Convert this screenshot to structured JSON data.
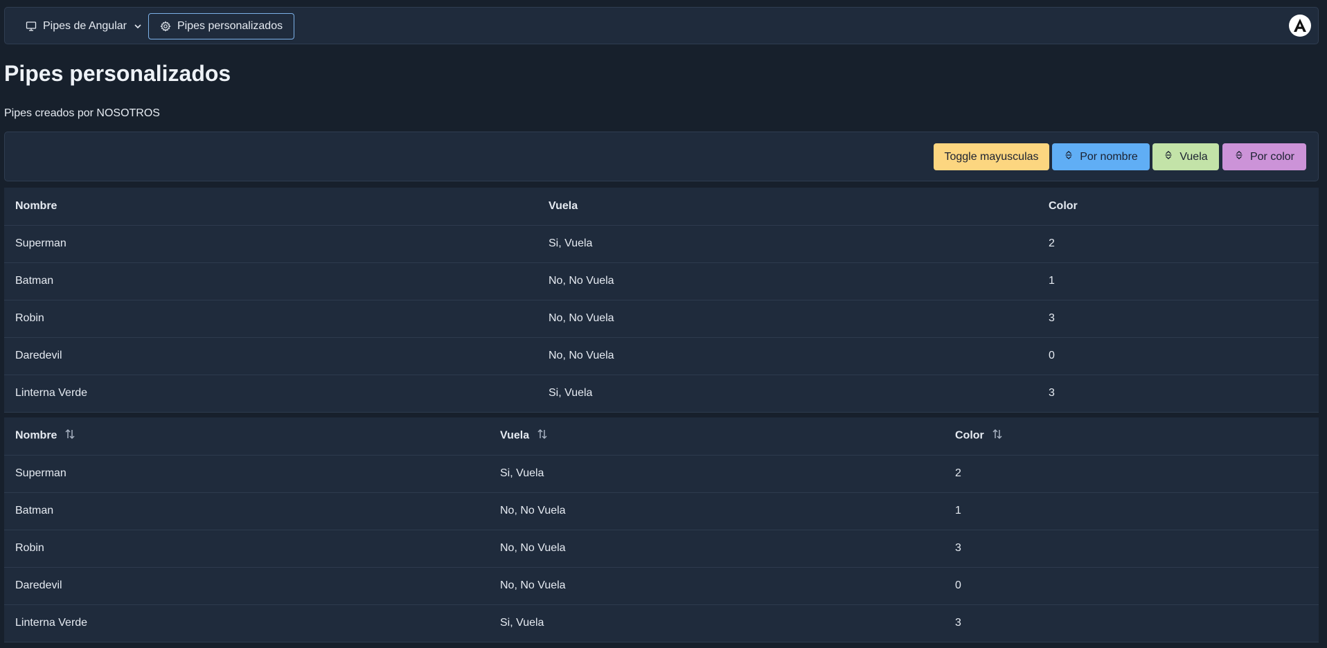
{
  "menubar": {
    "items": [
      {
        "label": "Pipes de Angular",
        "icon": "monitor-icon",
        "has_dropdown": true
      },
      {
        "label": "Pipes personalizados",
        "icon": "gear-icon",
        "active": true
      }
    ],
    "brand_icon": "angular-logo-icon"
  },
  "page": {
    "title": "Pipes personalizados",
    "subtitle": "Pipes creados por NOSOTROS"
  },
  "toolbar": {
    "buttons": [
      {
        "label": "Toggle mayusculas",
        "color": "#fcd680"
      },
      {
        "label": "Por nombre",
        "icon": "sort-alt-icon",
        "color": "#60aef5"
      },
      {
        "label": "Vuela",
        "icon": "sort-alt-icon",
        "color": "#c3e3a8"
      },
      {
        "label": "Por color",
        "icon": "sort-alt-icon",
        "color": "#cc93d8"
      }
    ]
  },
  "table1": {
    "headers": [
      "Nombre",
      "Vuela",
      "Color"
    ],
    "rows": [
      [
        "Superman",
        "Si, Vuela",
        "2"
      ],
      [
        "Batman",
        "No, No Vuela",
        "1"
      ],
      [
        "Robin",
        "No, No Vuela",
        "3"
      ],
      [
        "Daredevil",
        "No, No Vuela",
        "0"
      ],
      [
        "Linterna Verde",
        "Si, Vuela",
        "3"
      ]
    ]
  },
  "table2": {
    "headers": [
      "Nombre",
      "Vuela",
      "Color"
    ],
    "sortable": true,
    "rows": [
      [
        "Superman",
        "Si, Vuela",
        "2"
      ],
      [
        "Batman",
        "No, No Vuela",
        "1"
      ],
      [
        "Robin",
        "No, No Vuela",
        "3"
      ],
      [
        "Daredevil",
        "No, No Vuela",
        "0"
      ],
      [
        "Linterna Verde",
        "Si, Vuela",
        "3"
      ]
    ]
  },
  "colors": {
    "background": "#17202c",
    "panel": "#1f2b3c",
    "border": "#2f3d51",
    "active_border": "#7cb1e8"
  }
}
